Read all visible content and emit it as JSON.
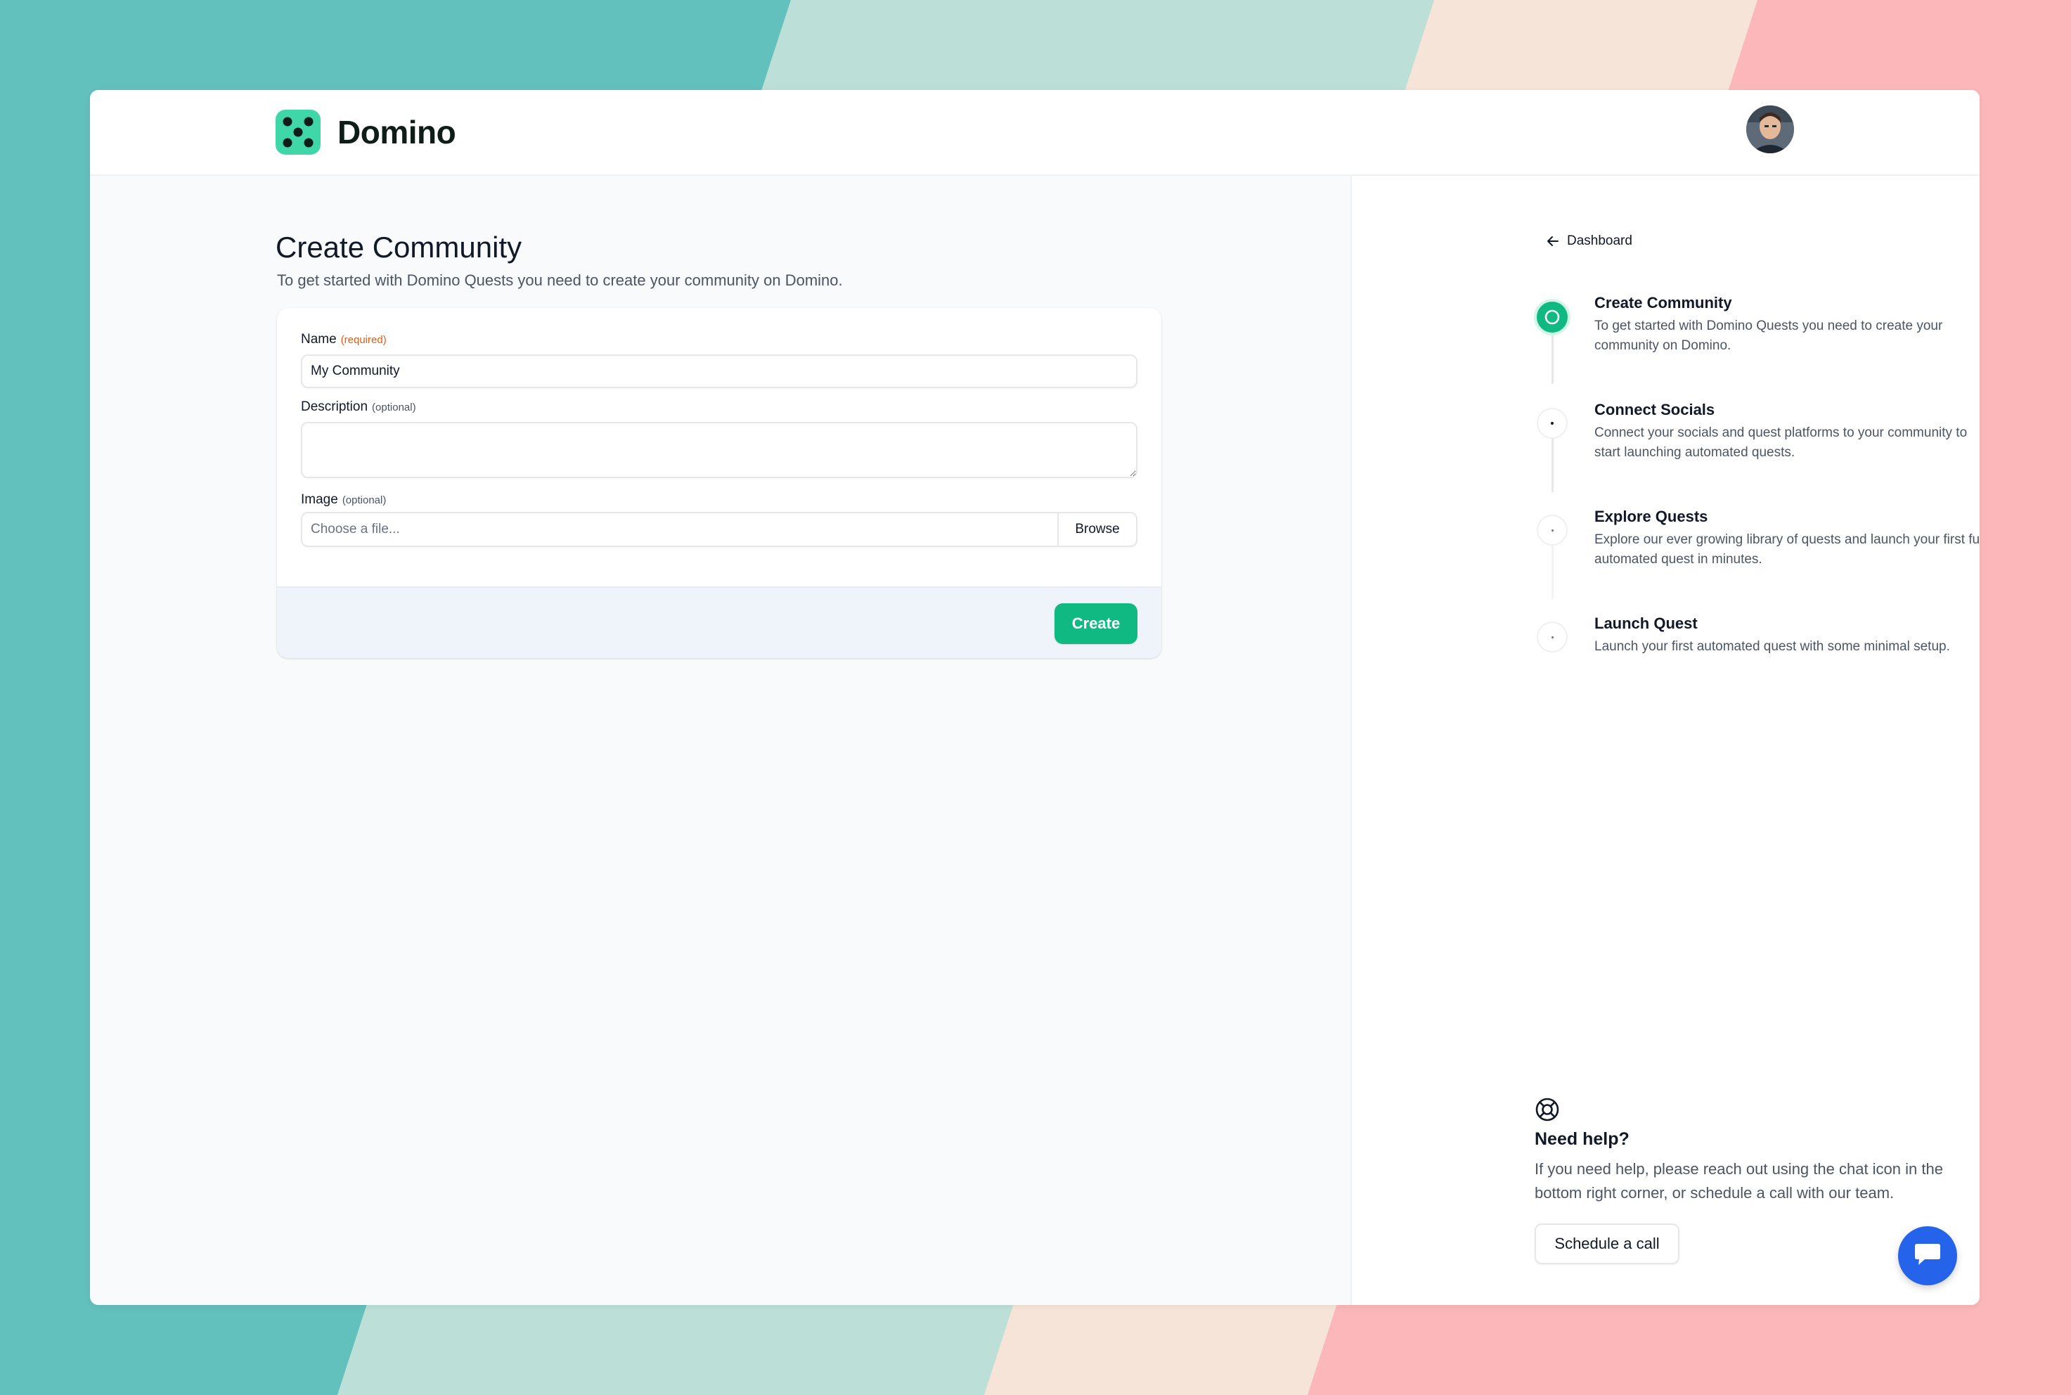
{
  "app": {
    "brand": "Domino"
  },
  "form": {
    "title": "Create Community",
    "subtitle": "To get started with Domino Quests you need to create your community on Domino.",
    "name_label": "Name",
    "name_hint": "(required)",
    "name_value": "My Community",
    "description_label": "Description",
    "description_hint": "(optional)",
    "description_value": "",
    "image_label": "Image",
    "image_hint": "(optional)",
    "image_placeholder": "Choose a file...",
    "browse_label": "Browse",
    "create_label": "Create"
  },
  "sidebar": {
    "back_label": "Dashboard",
    "steps": [
      {
        "title": "Create Community",
        "desc": "To get started with Domino Quests you need to create your community on Domino.",
        "active": true
      },
      {
        "title": "Connect Socials",
        "desc": "Connect your socials and quest platforms to your community to start launching automated quests.",
        "active": false
      },
      {
        "title": "Explore Quests",
        "desc": "Explore our ever growing library of quests and launch your first fully automated quest in minutes.",
        "active": false
      },
      {
        "title": "Launch Quest",
        "desc": "Launch your first automated quest with some minimal setup.",
        "active": false
      }
    ],
    "help_title": "Need help?",
    "help_text": "If you need help, please reach out using the chat icon in the bottom right corner, or schedule a call with our team.",
    "schedule_label": "Schedule a call"
  },
  "icons": {
    "logo": "dice-five-logo",
    "back": "arrow-left-icon",
    "help": "lifebuoy-icon",
    "chat": "chat-bubble-icon"
  },
  "colors": {
    "accent": "#10b981",
    "chat": "#2563eb",
    "required": "#ea580c",
    "bg_teal": "#62c0bd",
    "bg_mint": "#bce0d8",
    "bg_peach": "#f7e4d8",
    "bg_pink": "#fbb7b9"
  }
}
